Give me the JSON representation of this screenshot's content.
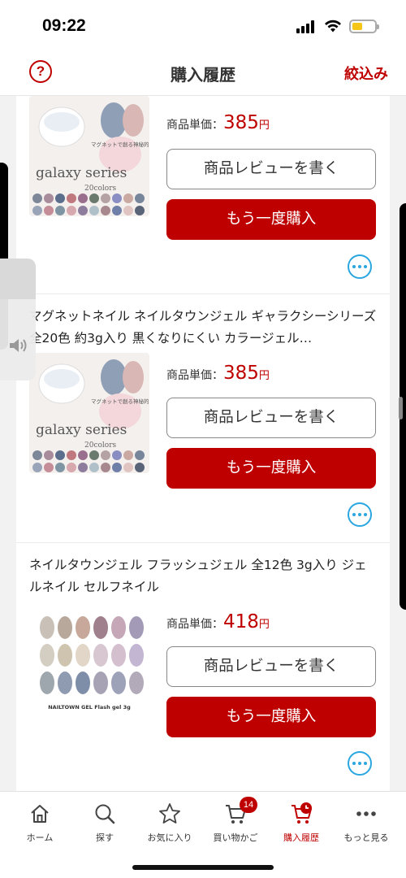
{
  "status_bar": {
    "time": "09:22"
  },
  "header": {
    "help_icon": "question-circle-icon",
    "title": "購入履歴",
    "filter_label": "絞込み"
  },
  "orders": [
    {
      "title": "",
      "price_label": "商品単価：",
      "price": "385",
      "currency": "円",
      "thumb_caption": "galaxy series",
      "thumb_sub": "20colors",
      "thumb_tag": "マグネットで創る神秘的な輝き",
      "review_label": "商品レビューを書く",
      "buy_label": "もう一度購入"
    },
    {
      "title": "マグネットネイル ネイルタウンジェル ギャラクシーシリーズ 全20色 約3g入り 黒くなりにくい カラージェル…",
      "price_label": "商品単価：",
      "price": "385",
      "currency": "円",
      "thumb_caption": "galaxy series",
      "thumb_sub": "20colors",
      "thumb_tag": "マグネットで創る神秘的な輝き",
      "review_label": "商品レビューを書く",
      "buy_label": "もう一度購入"
    },
    {
      "title": "ネイルタウンジェル フラッシュジェル 全12色 3g入り ジェルネイル セルフネイル",
      "price_label": "商品単価：",
      "price": "418",
      "currency": "円",
      "thumb_caption": "NAILTOWN GEL Flash gel 3g",
      "review_label": "商品レビューを書く",
      "buy_label": "もう一度購入"
    }
  ],
  "tab_bar": {
    "tabs": [
      {
        "label": "ホーム",
        "icon": "home-icon"
      },
      {
        "label": "探す",
        "icon": "search-icon"
      },
      {
        "label": "お気に入り",
        "icon": "star-icon"
      },
      {
        "label": "買い物かご",
        "icon": "cart-icon",
        "badge": "14"
      },
      {
        "label": "購入履歴",
        "icon": "purchase-history-icon",
        "active": true
      },
      {
        "label": "もっと見る",
        "icon": "more-dots-icon"
      }
    ]
  },
  "colors": {
    "brand_red": "#bf0000",
    "more_blue": "#2aa6e0"
  }
}
